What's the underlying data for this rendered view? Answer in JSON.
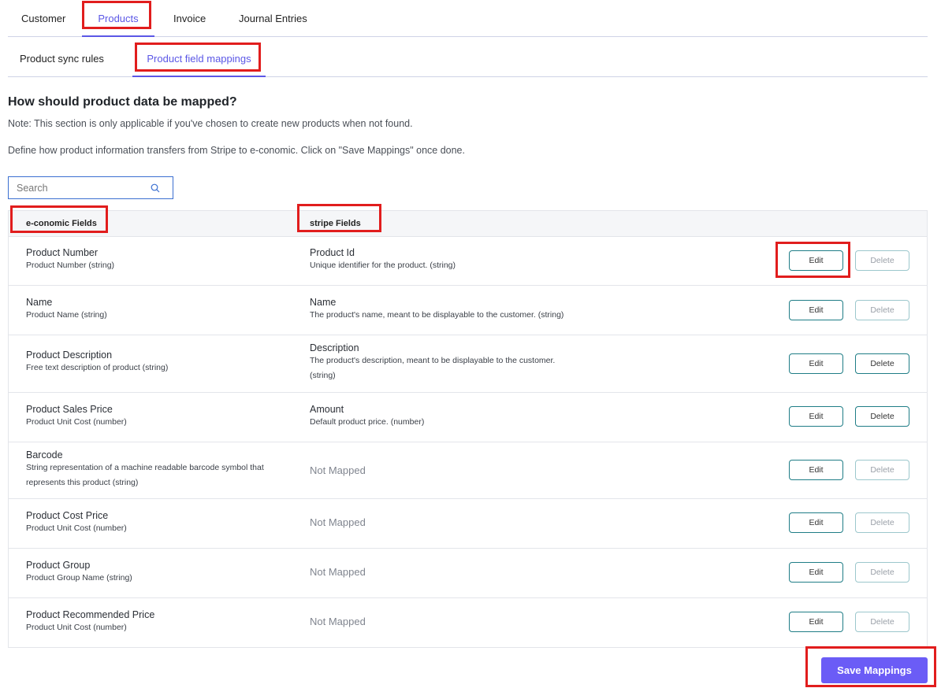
{
  "top_tabs": [
    {
      "label": "Customer"
    },
    {
      "label": "Products"
    },
    {
      "label": "Invoice"
    },
    {
      "label": "Journal Entries"
    }
  ],
  "sub_tabs": [
    {
      "label": "Product sync rules"
    },
    {
      "label": "Product field mappings"
    }
  ],
  "page": {
    "title": "How should product data be mapped?",
    "note": "Note: This section is only applicable if you've chosen to create new products when not found.",
    "description": "Define how product information transfers from Stripe to e-conomic. Click on \"Save Mappings\" once done."
  },
  "search": {
    "placeholder": "Search",
    "value": ""
  },
  "table": {
    "headers": {
      "economic": "e-conomic Fields",
      "stripe": "stripe Fields"
    },
    "rows": [
      {
        "e_name": "Product Number",
        "e_desc": "Product Number (string)",
        "s_name": "Product Id",
        "s_desc": "Unique identifier for the product. (string)",
        "edit": "Edit",
        "delete": "Delete",
        "delete_enabled": false
      },
      {
        "e_name": "Name",
        "e_desc": "Product Name (string)",
        "s_name": "Name",
        "s_desc": "The product's name, meant to be displayable to the customer. (string)",
        "edit": "Edit",
        "delete": "Delete",
        "delete_enabled": false
      },
      {
        "e_name": "Product Description",
        "e_desc": "Free text description of product (string)",
        "s_name": "Description",
        "s_desc": "The product's description, meant to be displayable to the customer. (string)",
        "edit": "Edit",
        "delete": "Delete",
        "delete_enabled": true
      },
      {
        "e_name": "Product Sales Price",
        "e_desc": "Product Unit Cost (number)",
        "s_name": "Amount",
        "s_desc": "Default product price. (number)",
        "edit": "Edit",
        "delete": "Delete",
        "delete_enabled": true
      },
      {
        "e_name": "Barcode",
        "e_desc": "String representation of a machine readable barcode symbol that represents this product (string)",
        "s_name": "Not Mapped",
        "s_desc": "",
        "edit": "Edit",
        "delete": "Delete",
        "delete_enabled": false
      },
      {
        "e_name": "Product Cost Price",
        "e_desc": "Product Unit Cost (number)",
        "s_name": "Not Mapped",
        "s_desc": "",
        "edit": "Edit",
        "delete": "Delete",
        "delete_enabled": false
      },
      {
        "e_name": "Product Group",
        "e_desc": "Product Group Name (string)",
        "s_name": "Not Mapped",
        "s_desc": "",
        "edit": "Edit",
        "delete": "Delete",
        "delete_enabled": false
      },
      {
        "e_name": "Product Recommended Price",
        "e_desc": "Product Unit Cost (number)",
        "s_name": "Not Mapped",
        "s_desc": "",
        "edit": "Edit",
        "delete": "Delete",
        "delete_enabled": false
      }
    ]
  },
  "save_button": "Save Mappings",
  "colors": {
    "accent": "#5b57e6",
    "save": "#6b5cf6",
    "button_border": "#1f7d86",
    "highlight": "#e11d1d"
  }
}
